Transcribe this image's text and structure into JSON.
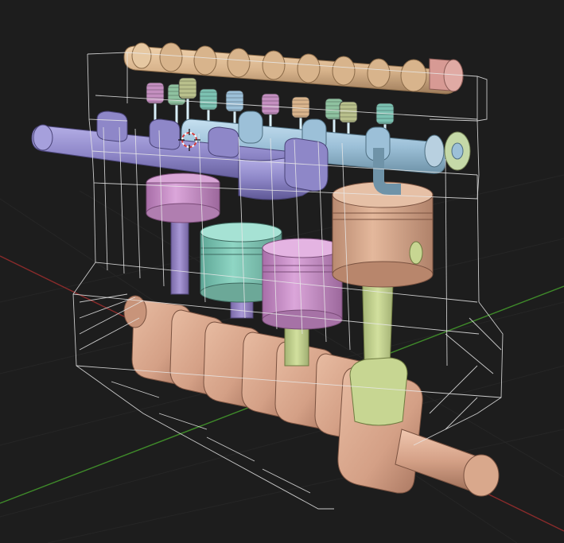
{
  "viewport": {
    "background": "#1d1d1d",
    "grid_color": "#262626",
    "axis_x_color": "#8a2b2b",
    "axis_y_color": "#3f8a2a",
    "wire_color": "#e8e8e8"
  },
  "engine": {
    "colors": {
      "camshaft": "#d8b48c",
      "camshaft_end": "#d79a94",
      "intake_manifold": "#8e87c8",
      "exhaust_manifold": "#9cc0d8",
      "exhaust_flange": "#c5d9a8",
      "crank": "#d4a086",
      "piston_pink": "#c48fc0",
      "piston_teal": "#7cc2b2",
      "piston_pink2": "#cf8fcf",
      "piston_tan": "#d5a58a",
      "rod_green": "#c7d692",
      "rod_purple": "#9886c6",
      "spring_colors": [
        "#c48fc0",
        "#8fc2a0",
        "#b9c08c",
        "#7cc2b2",
        "#9cc0d8",
        "#c48fc0",
        "#d9b48c",
        "#8fc2a0",
        "#b9c08c",
        "#7cc2b2"
      ]
    },
    "icons": {
      "cursor": "3d-cursor-icon"
    }
  }
}
